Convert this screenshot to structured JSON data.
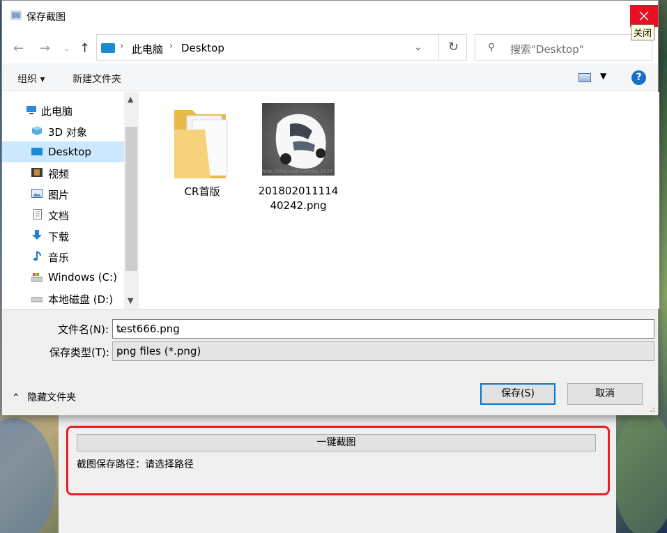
{
  "dialog": {
    "title": "保存截图",
    "close_tooltip": "关闭"
  },
  "nav": {
    "breadcrumb": [
      "此电脑",
      "Desktop"
    ],
    "search_placeholder": "搜索\"Desktop\""
  },
  "toolbar": {
    "organize": "组织 ▾",
    "new_folder": "新建文件夹",
    "help": "?"
  },
  "sidebar": {
    "items": [
      {
        "label": "此电脑",
        "icon": "computer-icon"
      },
      {
        "label": "3D 对象",
        "icon": "cube-icon"
      },
      {
        "label": "Desktop",
        "icon": "desktop-icon",
        "selected": true
      },
      {
        "label": "视频",
        "icon": "video-icon"
      },
      {
        "label": "图片",
        "icon": "picture-icon"
      },
      {
        "label": "文档",
        "icon": "document-icon"
      },
      {
        "label": "下载",
        "icon": "download-icon"
      },
      {
        "label": "音乐",
        "icon": "music-icon"
      },
      {
        "label": "Windows (C:)",
        "icon": "drive-icon"
      },
      {
        "label": "本地磁盘 (D:)",
        "icon": "drive-icon"
      }
    ]
  },
  "files": [
    {
      "name": "CR首版",
      "type": "folder"
    },
    {
      "name_line1": "201802011114",
      "name_line2": "40242.png",
      "type": "image"
    }
  ],
  "thumb_watermark": "http://blog.csdn.net/qq_1024",
  "footer": {
    "filename_label": "文件名(N):",
    "filename_value": "test666.png",
    "filetype_label": "保存类型(T):",
    "filetype_value": "png files (*.png)",
    "hide_folders": "隐藏文件夹",
    "save": "保存(S)",
    "cancel": "取消"
  },
  "app": {
    "capture_button": "一键截图",
    "path_label": "截图保存路径：请选择路径"
  },
  "colors": {
    "accent": "#0078d7",
    "close_red": "#e81123",
    "selected_bg": "#cce8ff",
    "highlight_red": "#e82020"
  }
}
